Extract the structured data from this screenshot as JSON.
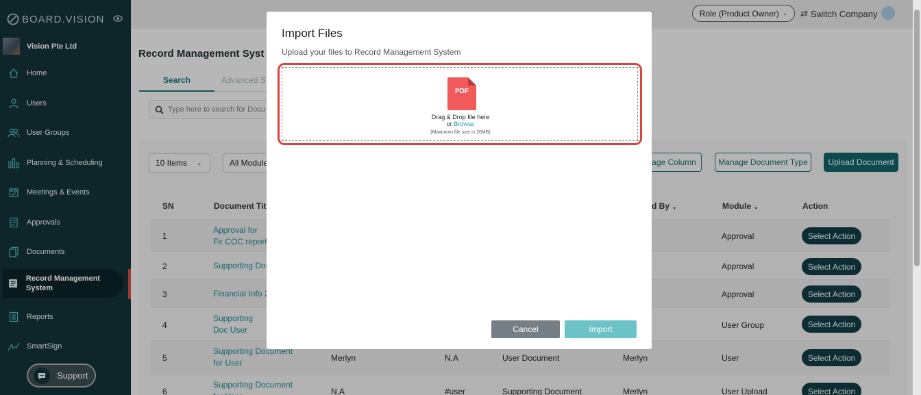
{
  "brand": {
    "name": "BOARD.VISION"
  },
  "company": {
    "name": "Vision Pte Ltd"
  },
  "sidebar": {
    "items": [
      {
        "label": "Home",
        "icon": "home-icon"
      },
      {
        "label": "Users",
        "icon": "user-icon"
      },
      {
        "label": "User Groups",
        "icon": "user-groups-icon"
      },
      {
        "label": "Planning & Scheduling",
        "icon": "bar-chart-icon"
      },
      {
        "label": "Meetings & Events",
        "icon": "calendar-icon"
      },
      {
        "label": "Approvals",
        "icon": "approval-icon"
      },
      {
        "label": "Documents",
        "icon": "documents-icon"
      },
      {
        "label": "Record Management System",
        "icon": "records-icon",
        "active": true
      },
      {
        "label": "Reports",
        "icon": "reports-icon"
      },
      {
        "label": "SmartSign",
        "icon": "signature-icon"
      }
    ],
    "support_label": "Support"
  },
  "header": {
    "role": "Role (Product Owner)",
    "switch_company": "Switch Company"
  },
  "page": {
    "title": "Record Management Syst",
    "tabs": [
      "Search",
      "Advanced S"
    ],
    "search_placeholder": "Type here to search for Docu",
    "items_select": "10 Items",
    "module_select": "All Module",
    "buttons": {
      "manage_column": "age Column",
      "manage_document_type": "Manage Document Type",
      "upload_document": "Upload Document"
    },
    "table": {
      "headers": {
        "sn": "SN",
        "title": "Document Title",
        "by": "d By",
        "module": "Module",
        "action": "Action"
      },
      "rows": [
        {
          "sn": "1",
          "title": "Approval for Fir COC report",
          "col3": "",
          "col4": "",
          "col5": "",
          "by": "",
          "module": "Approval",
          "action": "Select Action"
        },
        {
          "sn": "2",
          "title": "Supporting Doc",
          "col3": "",
          "col4": "",
          "col5": "",
          "by": "",
          "module": "Approval",
          "action": "Select Action"
        },
        {
          "sn": "3",
          "title": "Financial Info 2",
          "col3": "",
          "col4": "",
          "col5": "",
          "by": "",
          "module": "Approval",
          "action": "Select Action"
        },
        {
          "sn": "4",
          "title": "Supporting Doc User",
          "col3": "",
          "col4": "",
          "col5": "",
          "by": "",
          "module": "User Group",
          "action": "Select Action"
        },
        {
          "sn": "5",
          "title": "Supporting Document for User",
          "col3": "Merlyn",
          "col4": "N.A",
          "col5": "User Document",
          "by": "Merlyn",
          "module": "User",
          "action": "Select Action"
        },
        {
          "sn": "6",
          "title": "Supporting Document for User",
          "col3": "N.A",
          "col4": "#user",
          "col5": "Supporting Document",
          "by": "Merlyn",
          "module": "User Upload",
          "action": "Select Action"
        }
      ]
    }
  },
  "modal": {
    "title": "Import Files",
    "subtitle": "Upload your files to Record Management System",
    "pdf_label": "PDF",
    "drag_text": "Drag & Drop file here",
    "or_text": "or",
    "browse_text": "Browse",
    "max_size": "(Maximum file size is 20MB)",
    "cancel_label": "Cancel",
    "import_label": "Import"
  },
  "colors": {
    "sidebar_bg": "#123036",
    "accent": "#1a6b73",
    "dropzone_border": "#d9463b",
    "import_button": "#6bc3c8",
    "cancel_button": "#767f86"
  }
}
